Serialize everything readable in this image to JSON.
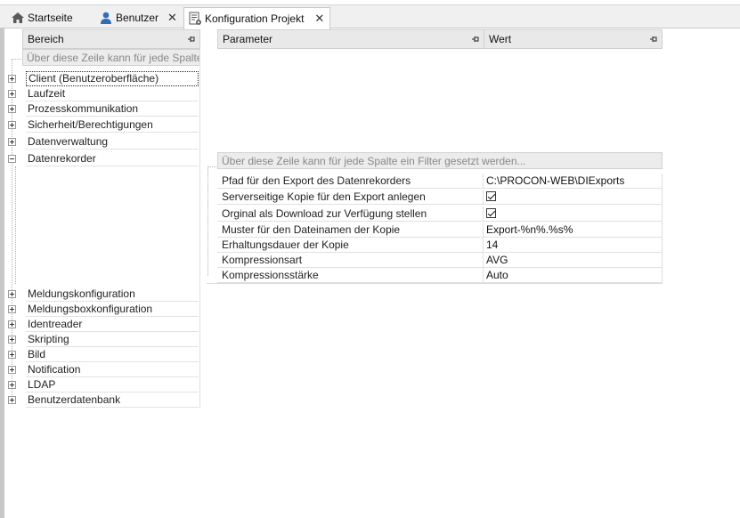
{
  "tabs": [
    {
      "label": "Startseite",
      "icon": "home-icon",
      "closable": false,
      "active": false
    },
    {
      "label": "Benutzer",
      "icon": "user-icon",
      "closable": true,
      "active": false
    },
    {
      "label": "Konfiguration Projekt",
      "icon": "config-document-icon",
      "closable": true,
      "active": true
    }
  ],
  "close_glyph": "✕",
  "tree": {
    "header": "Bereich",
    "filter_placeholder": "Über diese Zeile kann für jede Spalte...",
    "items": [
      {
        "label": "Client (Benutzeroberfläche)",
        "expanded": false,
        "selected": true
      },
      {
        "label": "Laufzeit",
        "expanded": false
      },
      {
        "label": "Prozesskommunikation",
        "expanded": false
      },
      {
        "label": "Sicherheit/Berechtigungen",
        "expanded": false
      },
      {
        "label": "Datenverwaltung",
        "expanded": false
      },
      {
        "label": "Datenrekorder",
        "expanded": true
      },
      {
        "label": "Meldungskonfiguration",
        "expanded": false
      },
      {
        "label": "Meldungsboxkonfiguration",
        "expanded": false
      },
      {
        "label": "Identreader",
        "expanded": false
      },
      {
        "label": "Skripting",
        "expanded": false
      },
      {
        "label": "Bild",
        "expanded": false
      },
      {
        "label": "Notification",
        "expanded": false
      },
      {
        "label": "LDAP",
        "expanded": false
      },
      {
        "label": "Benutzerdatenbank",
        "expanded": false
      }
    ]
  },
  "params": {
    "col_parameter": "Parameter",
    "col_value": "Wert",
    "filter_placeholder": "Über diese Zeile kann für jede Spalte ein Filter gesetzt werden...",
    "rows": [
      {
        "name": "Pfad für den Export des Datenrekorders",
        "value": "C:\\PROCON-WEB\\DIExports",
        "type": "text"
      },
      {
        "name": "Serverseitige Kopie für den Export anlegen",
        "value": "",
        "type": "checkbox",
        "checked": true
      },
      {
        "name": "Orginal als Download zur Verfügung stellen",
        "value": "",
        "type": "checkbox",
        "checked": true
      },
      {
        "name": "Muster für den Dateinamen der Kopie",
        "value": " Export-%n%.%s%",
        "type": "text"
      },
      {
        "name": "Erhaltungsdauer der Kopie",
        "value": "14",
        "type": "text"
      },
      {
        "name": "Kompressionsart",
        "value": "AVG",
        "type": "text"
      },
      {
        "name": "Kompressionsstärke",
        "value": "Auto",
        "type": "text"
      }
    ]
  }
}
